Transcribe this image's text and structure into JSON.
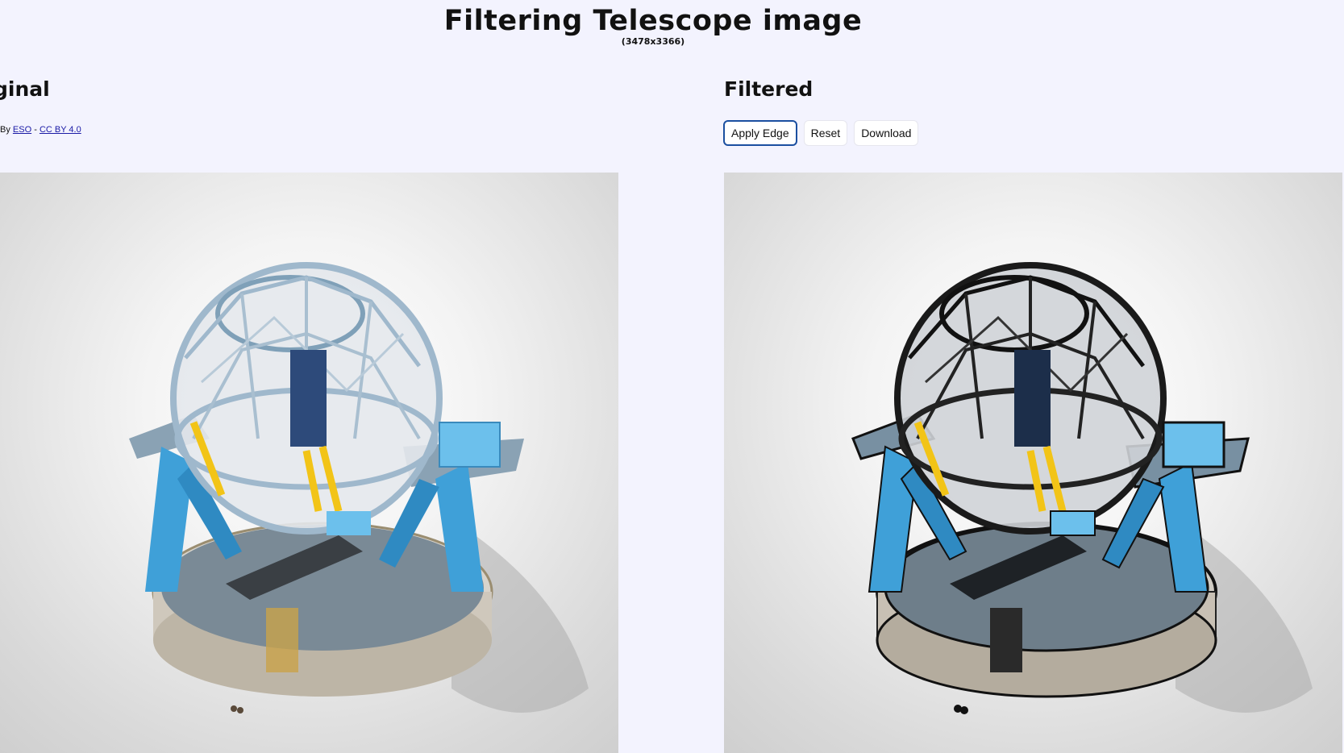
{
  "header": {
    "title": "Filtering Telescope image",
    "dimensions": "(3478x3366)"
  },
  "original": {
    "heading": "ginal",
    "credit": {
      "prefix": "By",
      "author": "ESO",
      "separator": "-",
      "license": "CC BY 4.0"
    }
  },
  "filtered": {
    "heading": "Filtered",
    "buttons": {
      "apply": "Apply Edge",
      "reset": "Reset",
      "download": "Download"
    }
  },
  "colors": {
    "background": "#f3f3fe",
    "active_button_border": "#1b4fa0",
    "link": "#1a1aa6",
    "structure_blue": "#3fa0d8",
    "frame_steel": "#9fb8cc",
    "accent_yellow": "#f2c417"
  }
}
